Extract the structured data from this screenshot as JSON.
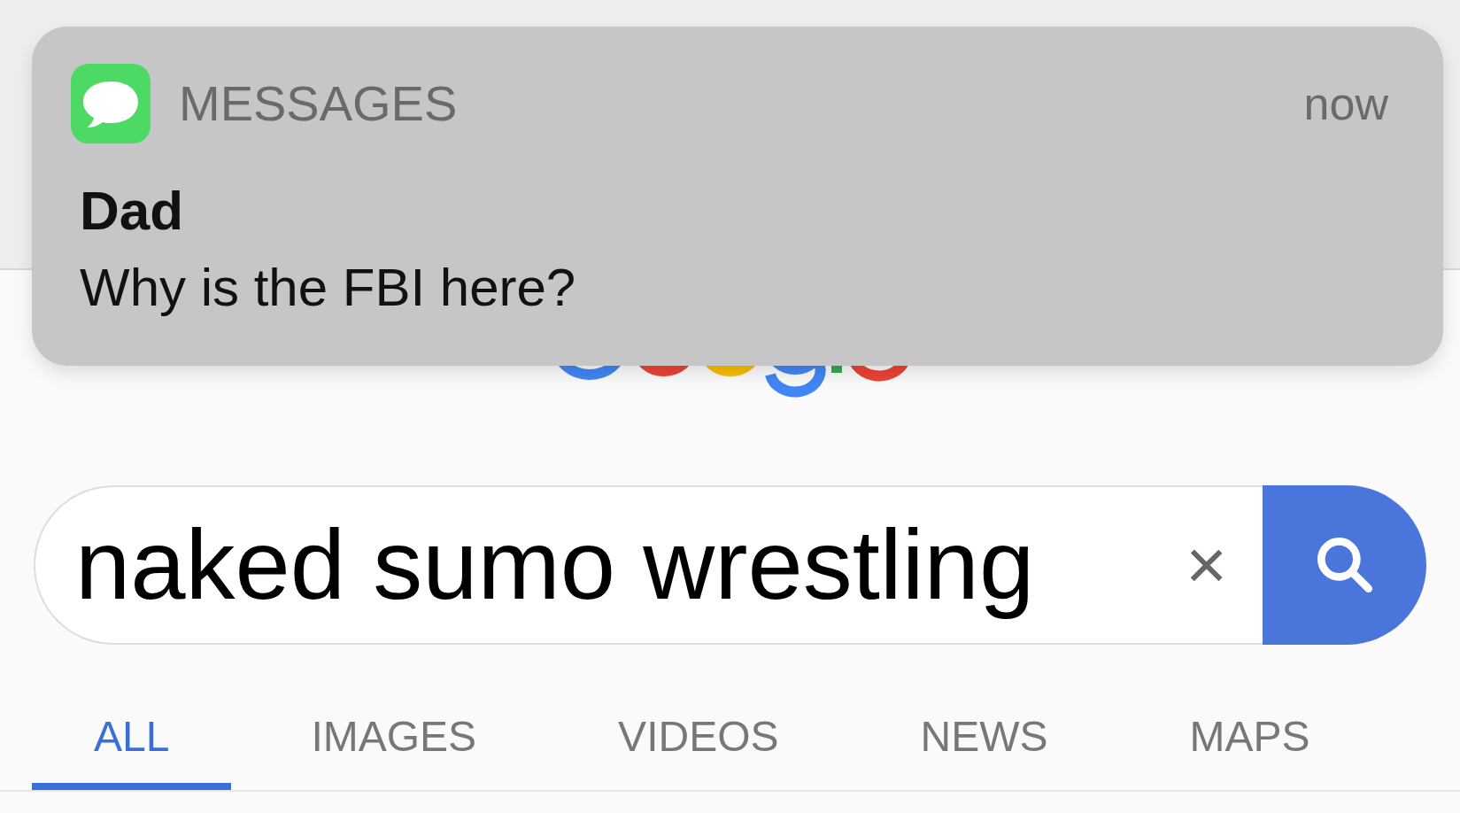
{
  "notification": {
    "app": "MESSAGES",
    "time": "now",
    "sender": "Dad",
    "message": "Why is the FBI here?"
  },
  "search": {
    "value": "naked sumo wrestling",
    "clear": "×"
  },
  "tabs": [
    {
      "label": "ALL",
      "selected": true
    },
    {
      "label": "IMAGES",
      "selected": false
    },
    {
      "label": "VIDEOS",
      "selected": false
    },
    {
      "label": "NEWS",
      "selected": false
    },
    {
      "label": "MAPS",
      "selected": false
    }
  ]
}
